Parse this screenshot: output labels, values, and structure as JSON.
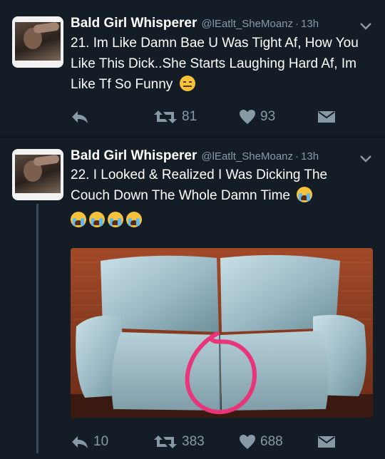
{
  "tweets": [
    {
      "name": "Bald Girl Whisperer",
      "handle": "@lEatlt_SheMoanz",
      "time": "13h",
      "text": "21. Im Like Damn Bae U Was Tight Af, How You Like This Dick..She Starts Laughing Hard Af, Im Like Tf So Funny",
      "emoji": [
        "expressionless-face"
      ],
      "replies": "",
      "retweets": "81",
      "likes": "93"
    },
    {
      "name": "Bald Girl Whisperer",
      "handle": "@lEatlt_SheMoanz",
      "time": "13h",
      "text": "22. I Looked & Realized I Was Dicking The Couch Down The Whole Damn Time",
      "emoji": [
        "crying-face",
        "crying-face",
        "crying-face",
        "crying-face",
        "crying-face"
      ],
      "replies": "10",
      "retweets": "383",
      "likes": "688"
    }
  ],
  "colors": {
    "background": "#141d26",
    "text": "#ffffff",
    "muted": "#8899a6",
    "thread_line": "#3b4a58",
    "circle_annotation": "#e8357a"
  },
  "icons": [
    "reply-icon",
    "retweet-icon",
    "heart-icon",
    "direct-message-icon",
    "chevron-down-icon"
  ]
}
